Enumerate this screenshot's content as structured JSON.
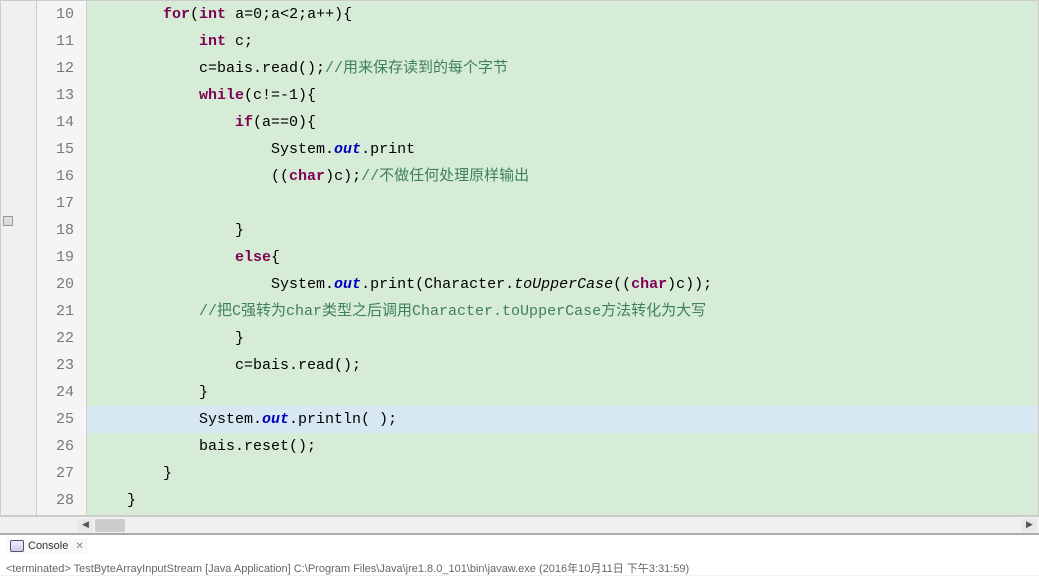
{
  "lines": [
    {
      "num": 10,
      "segments": [
        {
          "text": "        ",
          "cls": ""
        },
        {
          "text": "for",
          "cls": "kw"
        },
        {
          "text": "(",
          "cls": ""
        },
        {
          "text": "int",
          "cls": "kw"
        },
        {
          "text": " a=0;a<2;a++){",
          "cls": ""
        }
      ]
    },
    {
      "num": 11,
      "segments": [
        {
          "text": "            ",
          "cls": ""
        },
        {
          "text": "int",
          "cls": "kw"
        },
        {
          "text": " c;",
          "cls": ""
        }
      ]
    },
    {
      "num": 12,
      "segments": [
        {
          "text": "            c=bais.read();",
          "cls": ""
        },
        {
          "text": "//用来保存读到的每个字节",
          "cls": "comment"
        }
      ]
    },
    {
      "num": 13,
      "segments": [
        {
          "text": "            ",
          "cls": ""
        },
        {
          "text": "while",
          "cls": "kw"
        },
        {
          "text": "(c!=-1){",
          "cls": ""
        }
      ]
    },
    {
      "num": 14,
      "segments": [
        {
          "text": "                ",
          "cls": ""
        },
        {
          "text": "if",
          "cls": "kw"
        },
        {
          "text": "(a==0){",
          "cls": ""
        }
      ]
    },
    {
      "num": 15,
      "segments": [
        {
          "text": "                    System.",
          "cls": ""
        },
        {
          "text": "out",
          "cls": "static-field"
        },
        {
          "text": ".print",
          "cls": ""
        }
      ]
    },
    {
      "num": 16,
      "segments": [
        {
          "text": "                    ((",
          "cls": ""
        },
        {
          "text": "char",
          "cls": "kw"
        },
        {
          "text": ")c);",
          "cls": ""
        },
        {
          "text": "//不做任何处理原样输出",
          "cls": "comment"
        }
      ]
    },
    {
      "num": 17,
      "segments": [
        {
          "text": "                    ",
          "cls": ""
        }
      ]
    },
    {
      "num": 18,
      "segments": [
        {
          "text": "                }",
          "cls": ""
        }
      ]
    },
    {
      "num": 19,
      "segments": [
        {
          "text": "                ",
          "cls": ""
        },
        {
          "text": "else",
          "cls": "kw"
        },
        {
          "text": "{",
          "cls": ""
        }
      ]
    },
    {
      "num": 20,
      "segments": [
        {
          "text": "                    System.",
          "cls": ""
        },
        {
          "text": "out",
          "cls": "static-field"
        },
        {
          "text": ".print(Character.",
          "cls": ""
        },
        {
          "text": "toUpperCase",
          "cls": "static-method"
        },
        {
          "text": "((",
          "cls": ""
        },
        {
          "text": "char",
          "cls": "kw"
        },
        {
          "text": ")c));",
          "cls": ""
        }
      ]
    },
    {
      "num": 21,
      "segments": [
        {
          "text": "            ",
          "cls": ""
        },
        {
          "text": "//把C强转为char类型之后调用Character.toUpperCase方法转化为大写",
          "cls": "comment"
        }
      ]
    },
    {
      "num": 22,
      "segments": [
        {
          "text": "                }",
          "cls": ""
        }
      ]
    },
    {
      "num": 23,
      "segments": [
        {
          "text": "                c=bais.read();",
          "cls": ""
        }
      ]
    },
    {
      "num": 24,
      "segments": [
        {
          "text": "            }",
          "cls": ""
        }
      ]
    },
    {
      "num": 25,
      "highlighted": true,
      "segments": [
        {
          "text": "            System.",
          "cls": ""
        },
        {
          "text": "out",
          "cls": "static-field"
        },
        {
          "text": ".println( );",
          "cls": ""
        }
      ]
    },
    {
      "num": 26,
      "segments": [
        {
          "text": "            bais.reset();",
          "cls": ""
        }
      ]
    },
    {
      "num": 27,
      "segments": [
        {
          "text": "        }",
          "cls": ""
        }
      ]
    },
    {
      "num": 28,
      "segments": [
        {
          "text": "    }",
          "cls": ""
        }
      ]
    }
  ],
  "console": {
    "tab_label": "Console",
    "terminated_text": "<terminated> TestByteArrayInputStream [Java Application] C:\\Program Files\\Java\\jre1.8.0_101\\bin\\javaw.exe (2016年10月11日 下午3:31:59)"
  }
}
